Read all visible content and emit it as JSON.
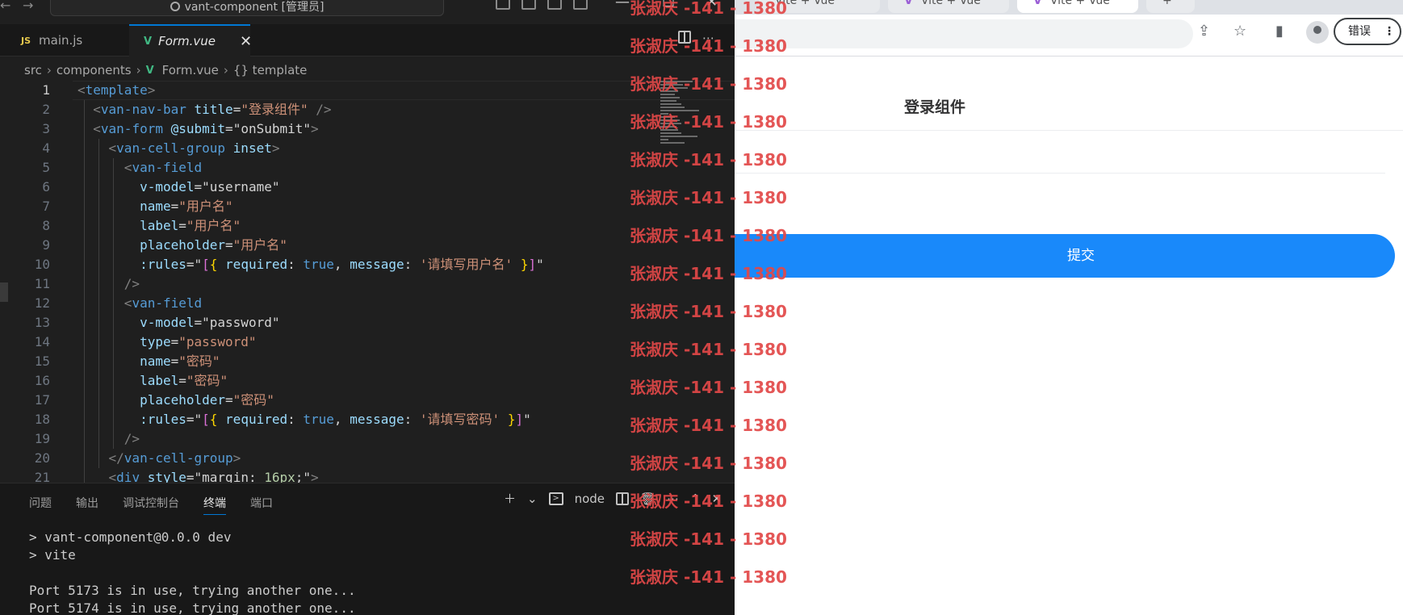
{
  "vscode": {
    "title": "vant-component [管理员]",
    "tabs": [
      {
        "label": "main.js",
        "badge": "JS"
      },
      {
        "label": "Form.vue",
        "badge": "V"
      }
    ],
    "breadcrumb": [
      "src",
      "components",
      "Form.vue",
      "{} template"
    ],
    "lines": [
      {
        "n": "1",
        "html": "<span class='t-br'>&lt;</span><span class='t-tag'>template</span><span class='t-br'>&gt;</span>"
      },
      {
        "n": "2",
        "html": "  <span class='t-br'>&lt;</span><span class='t-tag'>van-nav-bar</span> <span class='t-attr'>title</span><span class='t-txt'>=</span><span class='t-str'>\"登录组件\"</span> <span class='t-br'>/&gt;</span>"
      },
      {
        "n": "3",
        "html": "  <span class='t-br'>&lt;</span><span class='t-tag'>van-form</span> <span class='t-attr'>@submit</span><span class='t-txt'>=</span><span class='t-txt'>\"onSubmit\"</span><span class='t-br'>&gt;</span>"
      },
      {
        "n": "4",
        "html": "    <span class='t-br'>&lt;</span><span class='t-tag'>van-cell-group</span> <span class='t-attr'>inset</span><span class='t-br'>&gt;</span>"
      },
      {
        "n": "5",
        "html": "      <span class='t-br'>&lt;</span><span class='t-tag'>van-field</span>"
      },
      {
        "n": "6",
        "html": "        <span class='t-attr'>v-model</span><span class='t-txt'>=</span><span class='t-txt'>\"username\"</span>"
      },
      {
        "n": "7",
        "html": "        <span class='t-attr'>name</span><span class='t-txt'>=</span><span class='t-str'>\"用户名\"</span>"
      },
      {
        "n": "8",
        "html": "        <span class='t-attr'>label</span><span class='t-txt'>=</span><span class='t-str'>\"用户名\"</span>"
      },
      {
        "n": "9",
        "html": "        <span class='t-attr'>placeholder</span><span class='t-txt'>=</span><span class='t-str'>\"用户名\"</span>"
      },
      {
        "n": "10",
        "html": "        <span class='t-attr'>:rules</span><span class='t-txt'>=\"</span><span class='t-br2'>[</span><span class='t-br3'>{</span> <span class='t-attr'>required</span><span class='t-txt'>:</span> <span class='t-kw'>true</span><span class='t-txt'>,</span> <span class='t-attr'>message</span><span class='t-txt'>:</span> <span class='t-str'>'请填写用户名'</span> <span class='t-br3'>}</span><span class='t-br2'>]</span><span class='t-txt'>\"</span>"
      },
      {
        "n": "11",
        "html": "      <span class='t-br'>/&gt;</span>"
      },
      {
        "n": "12",
        "html": "      <span class='t-br'>&lt;</span><span class='t-tag'>van-field</span>"
      },
      {
        "n": "13",
        "html": "        <span class='t-attr'>v-model</span><span class='t-txt'>=</span><span class='t-txt'>\"password\"</span>"
      },
      {
        "n": "14",
        "html": "        <span class='t-attr'>type</span><span class='t-txt'>=</span><span class='t-str'>\"password\"</span>"
      },
      {
        "n": "15",
        "html": "        <span class='t-attr'>name</span><span class='t-txt'>=</span><span class='t-str'>\"密码\"</span>"
      },
      {
        "n": "16",
        "html": "        <span class='t-attr'>label</span><span class='t-txt'>=</span><span class='t-str'>\"密码\"</span>"
      },
      {
        "n": "17",
        "html": "        <span class='t-attr'>placeholder</span><span class='t-txt'>=</span><span class='t-str'>\"密码\"</span>"
      },
      {
        "n": "18",
        "html": "        <span class='t-attr'>:rules</span><span class='t-txt'>=\"</span><span class='t-br2'>[</span><span class='t-br3'>{</span> <span class='t-attr'>required</span><span class='t-txt'>:</span> <span class='t-kw'>true</span><span class='t-txt'>,</span> <span class='t-attr'>message</span><span class='t-txt'>:</span> <span class='t-str'>'请填写密码'</span> <span class='t-br3'>}</span><span class='t-br2'>]</span><span class='t-txt'>\"</span>"
      },
      {
        "n": "19",
        "html": "      <span class='t-br'>/&gt;</span>"
      },
      {
        "n": "20",
        "html": "    <span class='t-br'>&lt;/</span><span class='t-tag'>van-cell-group</span><span class='t-br'>&gt;</span>"
      },
      {
        "n": "21",
        "html": "    <span class='t-br'>&lt;</span><span class='t-tag'>div</span> <span class='t-attr'>style</span><span class='t-txt'>=\"margin: </span><span class='t-num'>16px</span><span class='t-txt'>;\"</span><span class='t-br'>&gt;</span>"
      }
    ],
    "panel_tabs": [
      "问题",
      "输出",
      "调试控制台",
      "终端",
      "端口"
    ],
    "panel_active": "终端",
    "terminal_name": "node",
    "terminal_lines": [
      "> vant-component@0.0.0 dev",
      "> vite",
      "",
      "Port 5173 is in use, trying another one...",
      "Port 5174 is in use, trying another one..."
    ]
  },
  "browser": {
    "tabs": [
      "Vite + Vue",
      "Vite + Vue",
      "Vite + Vue"
    ],
    "error_button": "错误",
    "nav_title": "登录组件",
    "submit_label": "提交"
  },
  "watermark": {
    "text": "张淑庆 -141 - 1380"
  },
  "colors": {
    "submit_blue": "#1989fa",
    "watermark_red": "#e24848",
    "vscode_accent": "#0078d4"
  }
}
